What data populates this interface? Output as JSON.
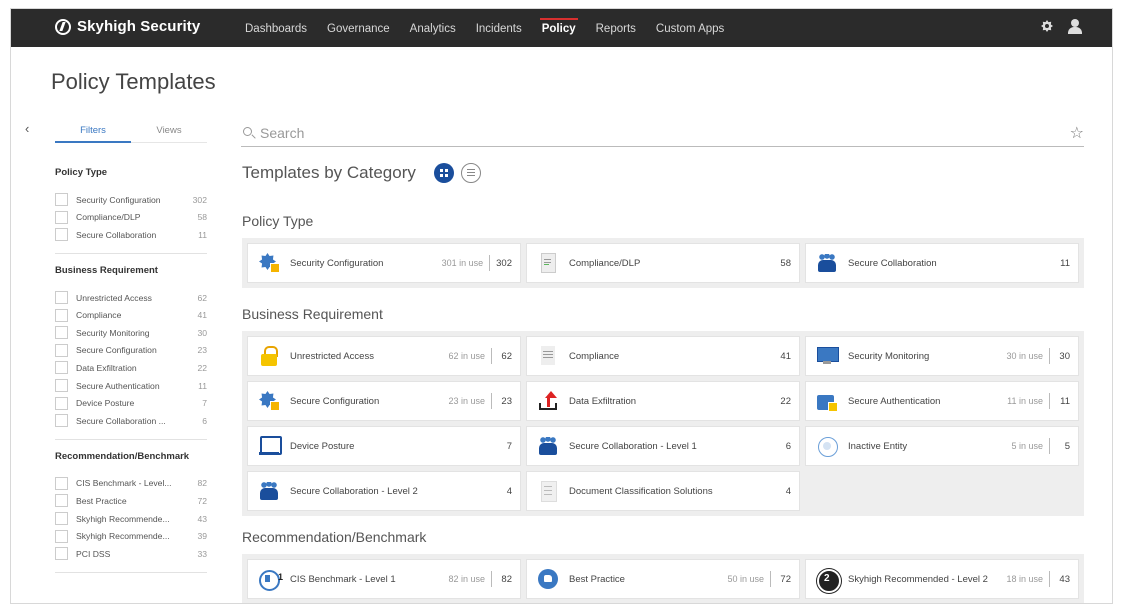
{
  "app": {
    "brand": "Skyhigh Security",
    "nav": [
      "Dashboards",
      "Governance",
      "Analytics",
      "Incidents",
      "Policy",
      "Reports",
      "Custom Apps"
    ],
    "active_nav": "Policy",
    "page_title": "Policy Templates",
    "collapse_glyph": "‹"
  },
  "filters": {
    "tabs": [
      "Filters",
      "Views"
    ],
    "active_tab": "Filters",
    "groups": [
      {
        "title": "Policy Type",
        "items": [
          {
            "label": "Security Configuration",
            "count": "302"
          },
          {
            "label": "Compliance/DLP",
            "count": "58"
          },
          {
            "label": "Secure Collaboration",
            "count": "11"
          }
        ]
      },
      {
        "title": "Business Requirement",
        "items": [
          {
            "label": "Unrestricted Access",
            "count": "62"
          },
          {
            "label": "Compliance",
            "count": "41"
          },
          {
            "label": "Security Monitoring",
            "count": "30"
          },
          {
            "label": "Secure Configuration",
            "count": "23"
          },
          {
            "label": "Data Exfiltration",
            "count": "22"
          },
          {
            "label": "Secure Authentication",
            "count": "11"
          },
          {
            "label": "Device Posture",
            "count": "7"
          },
          {
            "label": "Secure Collaboration ...",
            "count": "6"
          }
        ]
      },
      {
        "title": "Recommendation/Benchmark",
        "items": [
          {
            "label": "CIS Benchmark - Level...",
            "count": "82"
          },
          {
            "label": "Best Practice",
            "count": "72"
          },
          {
            "label": "Skyhigh Recommende...",
            "count": "43"
          },
          {
            "label": "Skyhigh Recommende...",
            "count": "39"
          },
          {
            "label": "PCI DSS",
            "count": "33"
          }
        ]
      }
    ]
  },
  "search": {
    "placeholder": "Search",
    "value": ""
  },
  "main": {
    "heading": "Templates by Category",
    "view_icons": [
      "grid-view-icon",
      "list-view-icon"
    ],
    "categories": [
      {
        "title": "Policy Type",
        "cards": [
          {
            "icon": "gear",
            "label": "Security Configuration",
            "in_use": "301 in use",
            "count": "302"
          },
          {
            "icon": "doc",
            "label": "Compliance/DLP",
            "in_use": "",
            "count": "58"
          },
          {
            "icon": "people",
            "label": "Secure Collaboration",
            "in_use": "",
            "count": "11"
          }
        ]
      },
      {
        "title": "Business Requirement",
        "cards": [
          {
            "icon": "lock",
            "label": "Unrestricted Access",
            "in_use": "62 in use",
            "count": "62"
          },
          {
            "icon": "list",
            "label": "Compliance",
            "in_use": "",
            "count": "41"
          },
          {
            "icon": "monitor",
            "label": "Security Monitoring",
            "in_use": "30 in use",
            "count": "30"
          },
          {
            "icon": "gear",
            "label": "Secure Configuration",
            "in_use": "23 in use",
            "count": "23"
          },
          {
            "icon": "upload",
            "label": "Data Exfiltration",
            "in_use": "",
            "count": "22"
          },
          {
            "icon": "auth",
            "label": "Secure Authentication",
            "in_use": "11 in use",
            "count": "11"
          },
          {
            "icon": "device",
            "label": "Device Posture",
            "in_use": "",
            "count": "7"
          },
          {
            "icon": "people",
            "label": "Secure Collaboration - Level 1",
            "in_use": "",
            "count": "6"
          },
          {
            "icon": "inactive",
            "label": "Inactive Entity",
            "in_use": "5 in use",
            "count": "5"
          },
          {
            "icon": "people",
            "label": "Secure Collaboration - Level 2",
            "in_use": "",
            "count": "4"
          },
          {
            "icon": "docgray",
            "label": "Document Classification Solutions",
            "in_use": "",
            "count": "4"
          }
        ]
      },
      {
        "title": "Recommendation/Benchmark",
        "cards": [
          {
            "icon": "cis",
            "label": "CIS Benchmark - Level 1",
            "in_use": "82 in use",
            "count": "82"
          },
          {
            "icon": "thumb",
            "label": "Best Practice",
            "in_use": "50 in use",
            "count": "72"
          },
          {
            "icon": "badge2",
            "label": "Skyhigh Recommended - Level 2",
            "in_use": "18 in use",
            "count": "43"
          }
        ]
      }
    ]
  },
  "colors": {
    "topbar": "#2b2b2b",
    "accent": "#3a78c2",
    "active_nav_marker": "#d8302f",
    "primary_dark": "#1a4e9c"
  }
}
